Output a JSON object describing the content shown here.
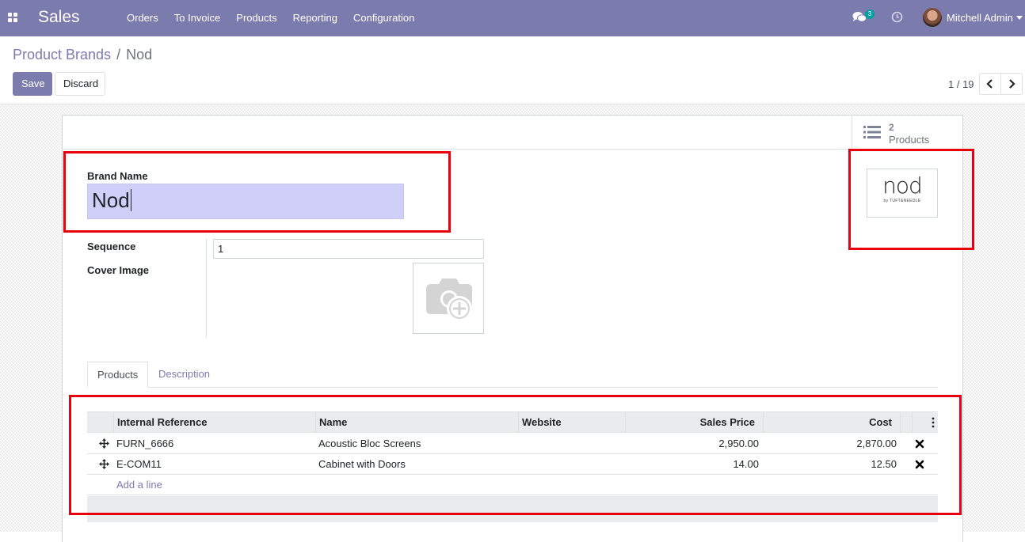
{
  "navbar": {
    "app_name": "Sales",
    "menu": [
      "Orders",
      "To Invoice",
      "Products",
      "Reporting",
      "Configuration"
    ],
    "chat_count": "3",
    "user_name": "Mitchell Admin"
  },
  "breadcrumb": {
    "parent": "Product Brands",
    "separator": "/",
    "current": "Nod"
  },
  "toolbar": {
    "save_label": "Save",
    "discard_label": "Discard"
  },
  "pager": {
    "value": "1 / 19"
  },
  "stat_button": {
    "value": "2",
    "label": "Products"
  },
  "form": {
    "brand_name_label": "Brand Name",
    "brand_name_value": "Nod",
    "sequence_label": "Sequence",
    "sequence_value": "1",
    "cover_image_label": "Cover Image"
  },
  "logo": {
    "main": "nod",
    "sub": "by TUFT&NEEDLE"
  },
  "tabs": [
    {
      "label": "Products",
      "active": true
    },
    {
      "label": "Description",
      "active": false
    }
  ],
  "table": {
    "columns": [
      "Internal Reference",
      "Name",
      "Website",
      "Sales Price",
      "Cost"
    ],
    "rows": [
      {
        "internal_reference": "FURN_6666",
        "name": "Acoustic Bloc Screens",
        "website": "",
        "sales_price": "2,950.00",
        "cost": "2,870.00"
      },
      {
        "internal_reference": "E-COM11",
        "name": "Cabinet with Doors",
        "website": "",
        "sales_price": "14.00",
        "cost": "12.50"
      }
    ],
    "add_line_label": "Add a line"
  },
  "colors": {
    "brand": "#7c7bad",
    "highlight": "#e8000d",
    "input_focus": "#cfcff9"
  }
}
